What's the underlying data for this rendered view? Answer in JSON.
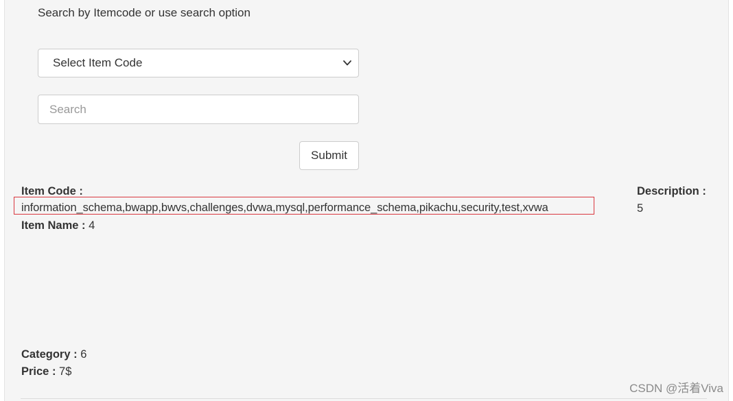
{
  "form": {
    "prompt": "Search by Itemcode or use search option",
    "select_value": "Select Item Code",
    "search_placeholder": "Search",
    "submit_label": "Submit"
  },
  "result": {
    "item_code_label": "Item Code :",
    "item_code_value": "information_schema,bwapp,bwvs,challenges,dvwa,mysql,performance_schema,pikachu,security,test,xvwa",
    "item_name_label": "Item Name :",
    "item_name_value": "4",
    "description_label": "Description  :",
    "description_value": "5",
    "category_label": "Category :",
    "category_value": "6",
    "price_label": "Price :",
    "price_value": "7$"
  },
  "watermark": "CSDN @活着Viva",
  "colors": {
    "panel_bg": "#f5f5f5",
    "highlight_border": "#d9363e"
  },
  "icons": {
    "select_arrow": "chevron-down-icon"
  }
}
